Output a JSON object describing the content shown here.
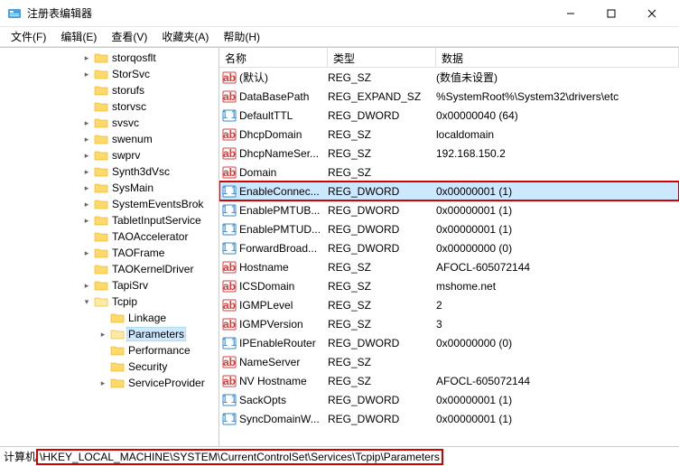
{
  "window": {
    "title": "注册表编辑器"
  },
  "menu": {
    "file": "文件(F)",
    "edit": "编辑(E)",
    "view": "查看(V)",
    "favorites": "收藏夹(A)",
    "help": "帮助(H)"
  },
  "tree": {
    "items": [
      {
        "label": "storqosflt",
        "indent": 90,
        "expander": ">"
      },
      {
        "label": "StorSvc",
        "indent": 90,
        "expander": ">"
      },
      {
        "label": "storufs",
        "indent": 90,
        "expander": ""
      },
      {
        "label": "storvsc",
        "indent": 90,
        "expander": ""
      },
      {
        "label": "svsvc",
        "indent": 90,
        "expander": ">"
      },
      {
        "label": "swenum",
        "indent": 90,
        "expander": ">"
      },
      {
        "label": "swprv",
        "indent": 90,
        "expander": ">"
      },
      {
        "label": "Synth3dVsc",
        "indent": 90,
        "expander": ">"
      },
      {
        "label": "SysMain",
        "indent": 90,
        "expander": ">"
      },
      {
        "label": "SystemEventsBrok",
        "indent": 90,
        "expander": ">"
      },
      {
        "label": "TabletInputService",
        "indent": 90,
        "expander": ">"
      },
      {
        "label": "TAOAccelerator",
        "indent": 90,
        "expander": ""
      },
      {
        "label": "TAOFrame",
        "indent": 90,
        "expander": ">"
      },
      {
        "label": "TAOKernelDriver",
        "indent": 90,
        "expander": ""
      },
      {
        "label": "TapiSrv",
        "indent": 90,
        "expander": ">"
      },
      {
        "label": "Tcpip",
        "indent": 90,
        "expander": "v"
      },
      {
        "label": "Linkage",
        "indent": 108,
        "expander": ""
      },
      {
        "label": "Parameters",
        "indent": 108,
        "expander": ">",
        "selected": true
      },
      {
        "label": "Performance",
        "indent": 108,
        "expander": ""
      },
      {
        "label": "Security",
        "indent": 108,
        "expander": ""
      },
      {
        "label": "ServiceProvider",
        "indent": 108,
        "expander": ">"
      }
    ]
  },
  "list": {
    "headers": {
      "name": "名称",
      "type": "类型",
      "data": "数据"
    },
    "rows": [
      {
        "icon": "ab",
        "name": "(默认)",
        "type": "REG_SZ",
        "data": "(数值未设置)"
      },
      {
        "icon": "ab",
        "name": "DataBasePath",
        "type": "REG_EXPAND_SZ",
        "data": "%SystemRoot%\\System32\\drivers\\etc"
      },
      {
        "icon": "01",
        "name": "DefaultTTL",
        "type": "REG_DWORD",
        "data": "0x00000040 (64)"
      },
      {
        "icon": "ab",
        "name": "DhcpDomain",
        "type": "REG_SZ",
        "data": "localdomain"
      },
      {
        "icon": "ab",
        "name": "DhcpNameSer...",
        "type": "REG_SZ",
        "data": "192.168.150.2"
      },
      {
        "icon": "ab",
        "name": "Domain",
        "type": "REG_SZ",
        "data": ""
      },
      {
        "icon": "01",
        "name": "EnableConnec...",
        "type": "REG_DWORD",
        "data": "0x00000001 (1)",
        "highlight": true
      },
      {
        "icon": "01",
        "name": "EnablePMTUB...",
        "type": "REG_DWORD",
        "data": "0x00000001 (1)"
      },
      {
        "icon": "01",
        "name": "EnablePMTUD...",
        "type": "REG_DWORD",
        "data": "0x00000001 (1)"
      },
      {
        "icon": "01",
        "name": "ForwardBroad...",
        "type": "REG_DWORD",
        "data": "0x00000000 (0)"
      },
      {
        "icon": "ab",
        "name": "Hostname",
        "type": "REG_SZ",
        "data": "AFOCL-605072144"
      },
      {
        "icon": "ab",
        "name": "ICSDomain",
        "type": "REG_SZ",
        "data": "mshome.net"
      },
      {
        "icon": "ab",
        "name": "IGMPLevel",
        "type": "REG_SZ",
        "data": "2"
      },
      {
        "icon": "ab",
        "name": "IGMPVersion",
        "type": "REG_SZ",
        "data": "3"
      },
      {
        "icon": "01",
        "name": "IPEnableRouter",
        "type": "REG_DWORD",
        "data": "0x00000000 (0)"
      },
      {
        "icon": "ab",
        "name": "NameServer",
        "type": "REG_SZ",
        "data": ""
      },
      {
        "icon": "ab",
        "name": "NV Hostname",
        "type": "REG_SZ",
        "data": "AFOCL-605072144"
      },
      {
        "icon": "01",
        "name": "SackOpts",
        "type": "REG_DWORD",
        "data": "0x00000001 (1)"
      },
      {
        "icon": "01",
        "name": "SyncDomainW...",
        "type": "REG_DWORD",
        "data": "0x00000001 (1)"
      }
    ]
  },
  "status": {
    "prefix": "计算机",
    "path": "\\HKEY_LOCAL_MACHINE\\SYSTEM\\CurrentControlSet\\Services\\Tcpip\\Parameters"
  }
}
